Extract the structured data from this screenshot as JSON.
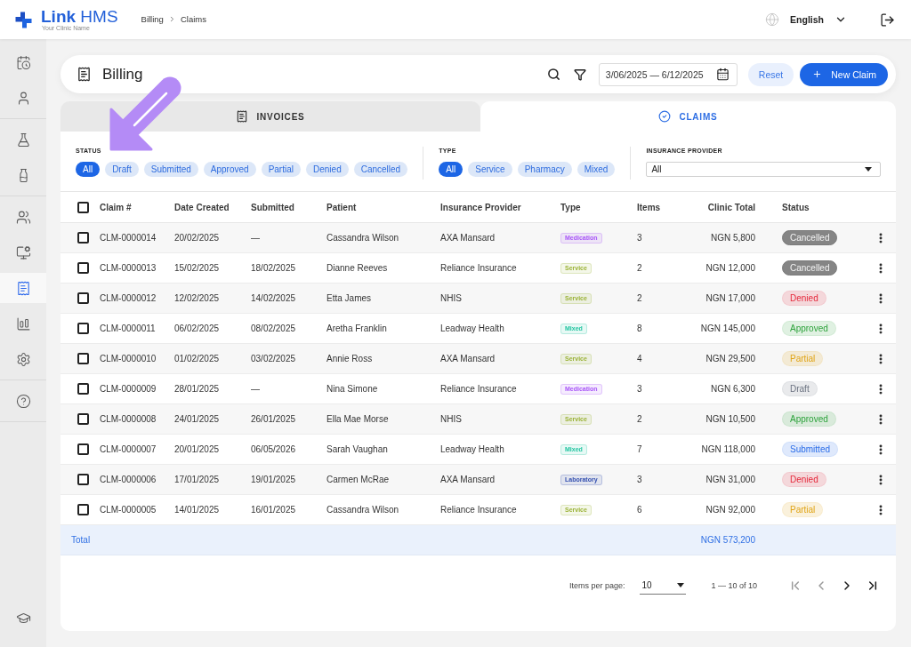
{
  "top_bar": {
    "app_name": "**Link** HMS",
    "clinic_name": "Your Clinic Name",
    "breadcrumbs": [
      "Billing",
      "Claims"
    ],
    "language": "English"
  },
  "sidebar": {
    "groups": [
      {
        "items": [
          {
            "selected": false
          },
          {
            "selected": false
          }
        ]
      },
      {
        "items": [
          {
            "selected": false
          },
          {
            "selected": false
          }
        ]
      },
      {
        "items": [
          {
            "selected": false
          },
          {
            "selected": false
          },
          {
            "selected": true
          },
          {
            "selected": false
          },
          {
            "selected": false
          }
        ]
      },
      {
        "items": [
          {
            "selected": false
          }
        ]
      }
    ],
    "bottom_items": [
      {
        "selected": false
      }
    ]
  },
  "header": {
    "title": "Billing",
    "date_range": "3/06/2025 — 6/12/2025",
    "buttons": [
      {
        "label": "Reset",
        "kind": "secondary"
      },
      {
        "label": "New Claim",
        "kind": "primary"
      }
    ]
  },
  "tabs": [
    {
      "label": "INVOICES",
      "selected": false
    },
    {
      "label": "CLAIMS",
      "selected": true
    }
  ],
  "filters": {
    "status": {
      "label": "STATUS",
      "options": [
        {
          "label": "All",
          "selected": true
        },
        {
          "label": "Draft",
          "selected": false
        },
        {
          "label": "Submitted",
          "selected": false
        },
        {
          "label": "Approved",
          "selected": false
        },
        {
          "label": "Partial",
          "selected": false
        },
        {
          "label": "Denied",
          "selected": false
        },
        {
          "label": "Cancelled",
          "selected": false
        }
      ]
    },
    "type": {
      "label": "TYPE",
      "options": [
        {
          "label": "All",
          "selected": true
        },
        {
          "label": "Service",
          "selected": false
        },
        {
          "label": "Pharmacy",
          "selected": false
        },
        {
          "label": "Mixed",
          "selected": false
        }
      ]
    },
    "insurance_provider": {
      "label": "INSURANCE PROVIDER",
      "value": "All"
    }
  },
  "table": {
    "select_all": {
      "checked": false
    },
    "columns": [
      "Claim #",
      "Date Created",
      "Submitted",
      "Patient",
      "Insurance Provider",
      "Type",
      "Items",
      "Clinic Total",
      "Status"
    ],
    "rows": [
      {
        "checked": false,
        "claim": "CLM-0000014",
        "date_created": "20/02/2025",
        "submitted": "—",
        "patient": "Cassandra Wilson",
        "insurance_provider": "AXA Mansard",
        "type": {
          "label": "Medication",
          "color": "#a855f7"
        },
        "items": "3",
        "clinic_total": "NGN 5,800",
        "status": {
          "label": "Cancelled",
          "color": "#858585",
          "filled": true
        }
      },
      {
        "checked": false,
        "claim": "CLM-0000013",
        "date_created": "15/02/2025",
        "submitted": "18/02/2025",
        "patient": "Dianne Reeves",
        "insurance_provider": "Reliance Insurance",
        "type": {
          "label": "Service",
          "color": "#9ab236"
        },
        "items": "2",
        "clinic_total": "NGN 12,000",
        "status": {
          "label": "Cancelled",
          "color": "#858585",
          "filled": true
        }
      },
      {
        "checked": false,
        "claim": "CLM-0000012",
        "date_created": "12/02/2025",
        "submitted": "14/02/2025",
        "patient": "Etta James",
        "insurance_provider": "NHIS",
        "type": {
          "label": "Service",
          "color": "#9ab236"
        },
        "items": "2",
        "clinic_total": "NGN 17,000",
        "status": {
          "label": "Denied",
          "color": "#e5283b",
          "filled": false
        }
      },
      {
        "checked": false,
        "claim": "CLM-0000011",
        "date_created": "06/02/2025",
        "submitted": "08/02/2025",
        "patient": "Aretha Franklin",
        "insurance_provider": "Leadway Health",
        "type": {
          "label": "Mixed",
          "color": "#22c4a0"
        },
        "items": "8",
        "clinic_total": "NGN 145,000",
        "status": {
          "label": "Approved",
          "color": "#2ea33c",
          "filled": false
        }
      },
      {
        "checked": false,
        "claim": "CLM-0000010",
        "date_created": "01/02/2025",
        "submitted": "03/02/2025",
        "patient": "Annie Ross",
        "insurance_provider": "AXA Mansard",
        "type": {
          "label": "Service",
          "color": "#9ab236"
        },
        "items": "4",
        "clinic_total": "NGN 29,500",
        "status": {
          "label": "Partial",
          "color": "#e0a416",
          "filled": false
        }
      },
      {
        "checked": false,
        "claim": "CLM-0000009",
        "date_created": "28/01/2025",
        "submitted": "—",
        "patient": "Nina Simone",
        "insurance_provider": "Reliance Insurance",
        "type": {
          "label": "Medication",
          "color": "#a855f7"
        },
        "items": "3",
        "clinic_total": "NGN 6,300",
        "status": {
          "label": "Draft",
          "color": "#6b7280",
          "filled": false
        }
      },
      {
        "checked": false,
        "claim": "CLM-0000008",
        "date_created": "24/01/2025",
        "submitted": "26/01/2025",
        "patient": "Ella Mae Morse",
        "insurance_provider": "NHIS",
        "type": {
          "label": "Service",
          "color": "#9ab236"
        },
        "items": "2",
        "clinic_total": "NGN 10,500",
        "status": {
          "label": "Approved",
          "color": "#2ea33c",
          "filled": false
        }
      },
      {
        "checked": false,
        "claim": "CLM-0000007",
        "date_created": "20/01/2025",
        "submitted": "06/05/2026",
        "patient": "Sarah Vaughan",
        "insurance_provider": "Leadway Health",
        "type": {
          "label": "Mixed",
          "color": "#22c4a0"
        },
        "items": "7",
        "clinic_total": "NGN 118,000",
        "status": {
          "label": "Submitted",
          "color": "#2b6de8",
          "filled": false
        }
      },
      {
        "checked": false,
        "claim": "CLM-0000006",
        "date_created": "17/01/2025",
        "submitted": "19/01/2025",
        "patient": "Carmen McRae",
        "insurance_provider": "AXA Mansard",
        "type": {
          "label": "Laboratory",
          "color": "#3450b0"
        },
        "items": "3",
        "clinic_total": "NGN 31,000",
        "status": {
          "label": "Denied",
          "color": "#e5283b",
          "filled": false
        }
      },
      {
        "checked": false,
        "claim": "CLM-0000005",
        "date_created": "14/01/2025",
        "submitted": "16/01/2025",
        "patient": "Cassandra Wilson",
        "insurance_provider": "Reliance Insurance",
        "type": {
          "label": "Service",
          "color": "#9ab236"
        },
        "items": "6",
        "clinic_total": "NGN 92,000",
        "status": {
          "label": "Partial",
          "color": "#e0a416",
          "filled": false
        }
      }
    ],
    "total": {
      "label": "Total",
      "value": "NGN 573,200"
    }
  },
  "pagination": {
    "per_page_label": "Items per page:",
    "per_page": "10",
    "range": "1 — 10 of 10",
    "buttons": [
      {
        "disabled": true
      },
      {
        "disabled": true
      },
      {
        "disabled": false
      },
      {
        "disabled": false
      }
    ]
  }
}
